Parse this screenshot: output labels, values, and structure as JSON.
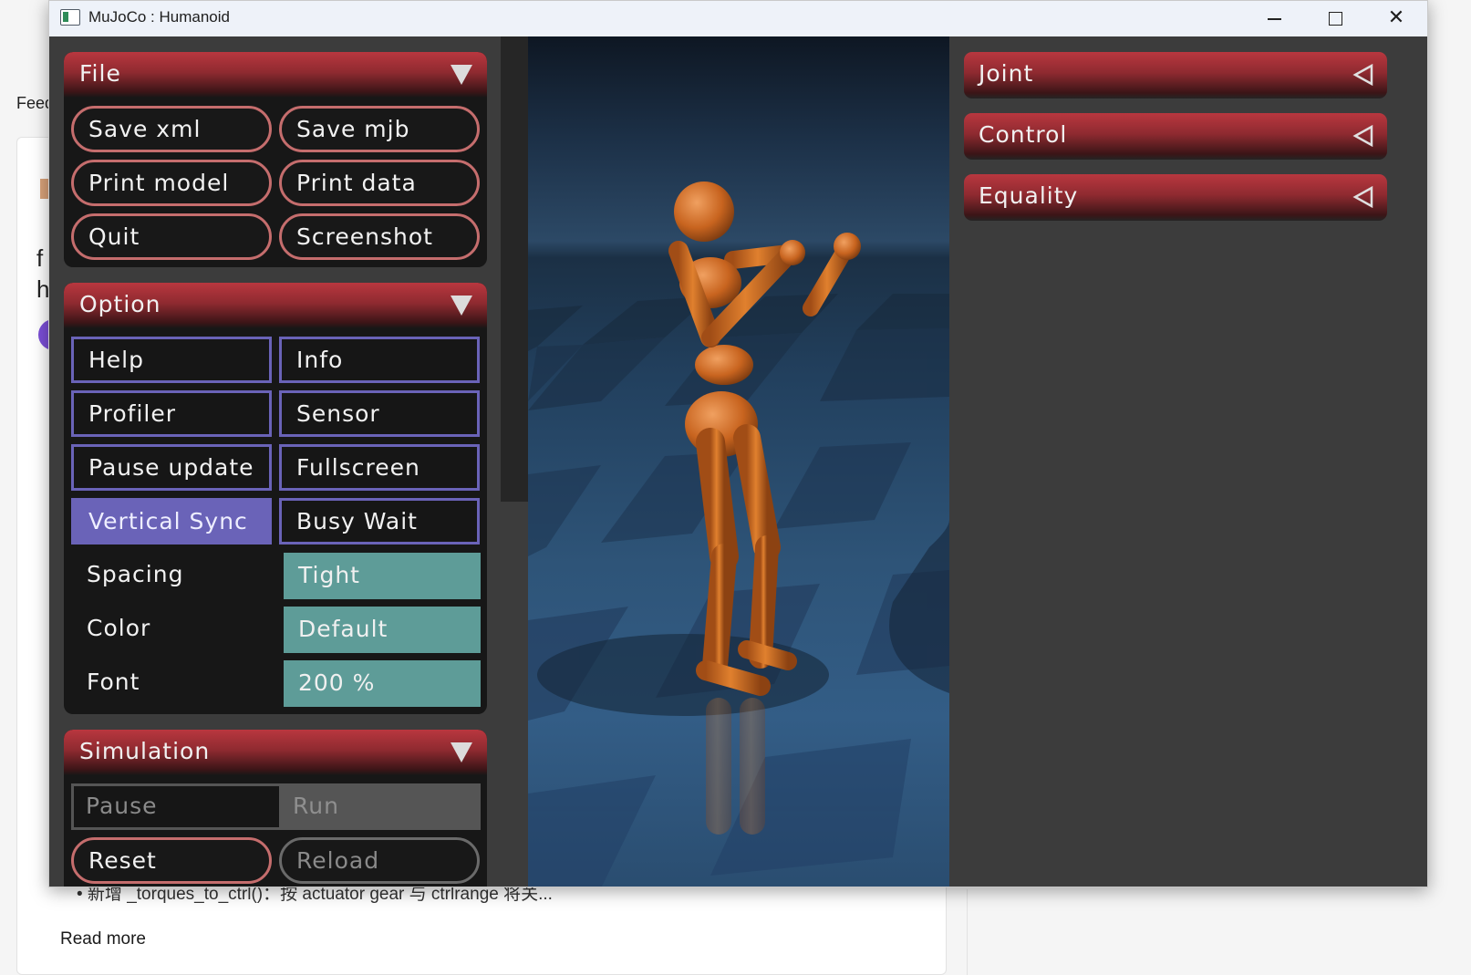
{
  "background_page": {
    "feed_label": "Feed",
    "char1": "f",
    "char2": "h",
    "bullet_text": "• 新增 _torques_to_ctrl()：按 actuator gear 与 ctrlrange 将关...",
    "read_more": "Read more"
  },
  "window": {
    "title": "MuJoCo : Humanoid",
    "minimize": "",
    "maximize": "",
    "close": "✕"
  },
  "file_section": {
    "title": "File",
    "buttons": [
      "Save xml",
      "Save mjb",
      "Print model",
      "Print data",
      "Quit",
      "Screenshot"
    ]
  },
  "option_section": {
    "title": "Option",
    "buttons": [
      "Help",
      "Info",
      "Profiler",
      "Sensor",
      "Pause update",
      "Fullscreen",
      "Vertical Sync",
      "Busy Wait"
    ],
    "active_button": "Vertical Sync",
    "rows": [
      {
        "label": "Spacing",
        "value": "Tight"
      },
      {
        "label": "Color",
        "value": "Default"
      },
      {
        "label": "Font",
        "value": "200 %"
      }
    ]
  },
  "simulation_section": {
    "title": "Simulation",
    "radio": {
      "left": "Pause",
      "right": "Run",
      "selected": "Run"
    },
    "buttons": [
      "Reset",
      "Reload"
    ]
  },
  "right_sections": [
    "Joint",
    "Control",
    "Equality"
  ],
  "colors": {
    "header_red": "#b9373f",
    "round_button_border": "#c56d6d",
    "square_button_border": "#6a63b8",
    "select_teal": "#5e9c98",
    "humanoid_orange": "#c8641f"
  }
}
